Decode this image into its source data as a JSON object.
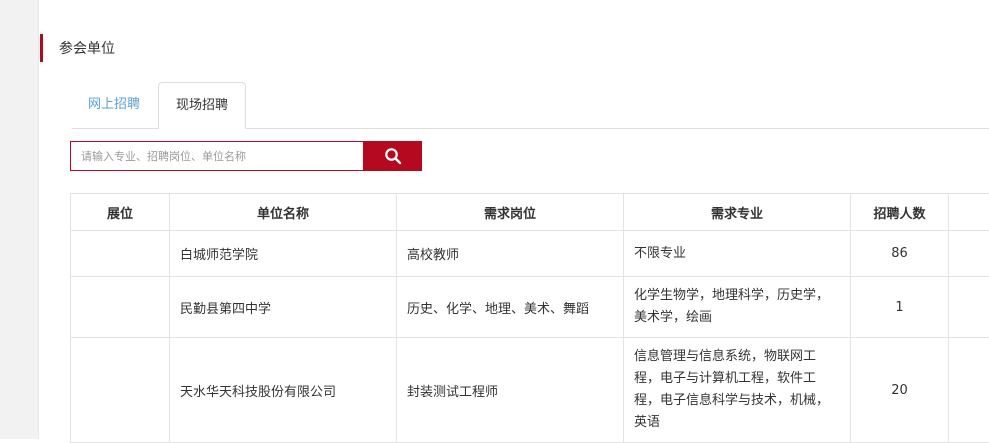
{
  "section": {
    "title": "参会单位"
  },
  "tabs": [
    {
      "label": "网上招聘",
      "active": false
    },
    {
      "label": "现场招聘",
      "active": true
    }
  ],
  "search": {
    "value": "",
    "placeholder": "请输入专业、招聘岗位、单位名称",
    "button_icon": "search-icon"
  },
  "table": {
    "headers": [
      "展位",
      "单位名称",
      "需求岗位",
      "需求专业",
      "招聘人数"
    ],
    "rows": [
      {
        "booth": "",
        "company": "白城师范学院",
        "position": "高校教师",
        "major": "不限专业",
        "count": "86"
      },
      {
        "booth": "",
        "company": "民勤县第四中学",
        "position": "历史、化学、地理、美术、舞蹈",
        "major": "化学生物学，地理科学，历史学，美术学，绘画",
        "count": "1"
      },
      {
        "booth": "",
        "company": "天水华天科技股份有限公司",
        "position": "封装测试工程师",
        "major": "信息管理与信息系统，物联网工程，电子与计算机工程，软件工程，电子信息科学与技术，机械，英语",
        "count": "20"
      }
    ]
  },
  "colors": {
    "accent": "#b5091f",
    "tab_link": "#5aa0d8"
  }
}
